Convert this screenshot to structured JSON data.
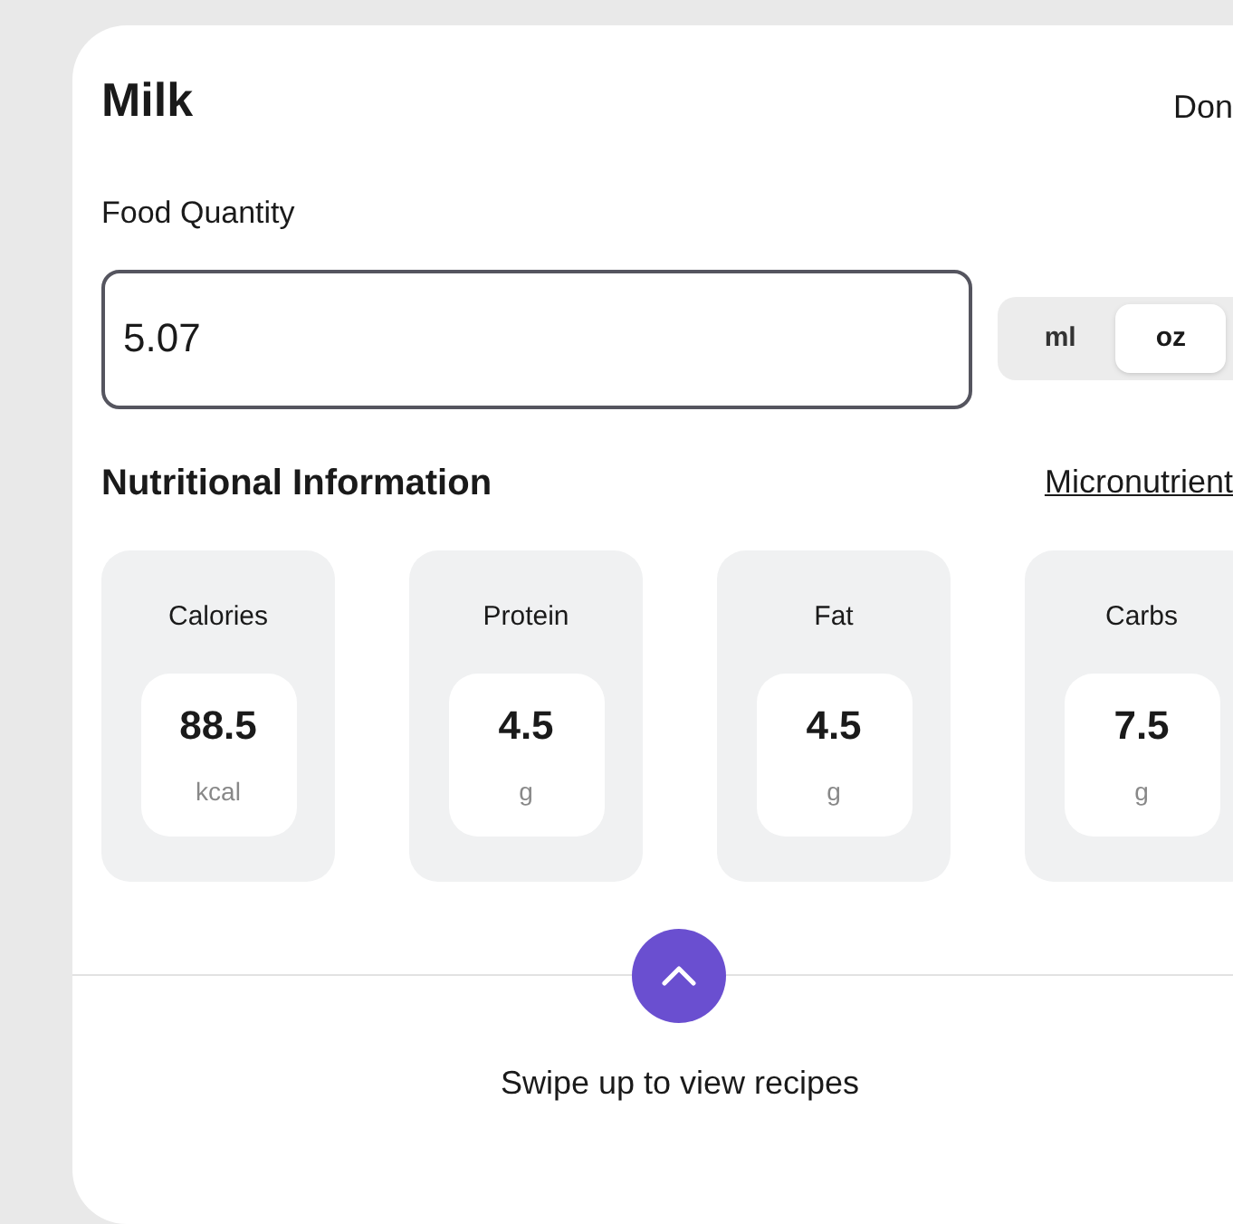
{
  "title": "Milk",
  "done": "Don",
  "quantity_label": "Food Quantity",
  "quantity": {
    "value": "5.07"
  },
  "units": [
    {
      "label": "ml",
      "selected": false
    },
    {
      "label": "oz",
      "selected": true
    }
  ],
  "section_title": "Nutritional Information",
  "micronutrients_link": "Micronutrient",
  "nutrients": [
    {
      "name": "Calories",
      "value": "88.5",
      "unit": "kcal"
    },
    {
      "name": "Protein",
      "value": "4.5",
      "unit": "g"
    },
    {
      "name": "Fat",
      "value": "4.5",
      "unit": "g"
    },
    {
      "name": "Carbs",
      "value": "7.5",
      "unit": "g"
    }
  ],
  "swipe_hint": "Swipe up to view recipes"
}
